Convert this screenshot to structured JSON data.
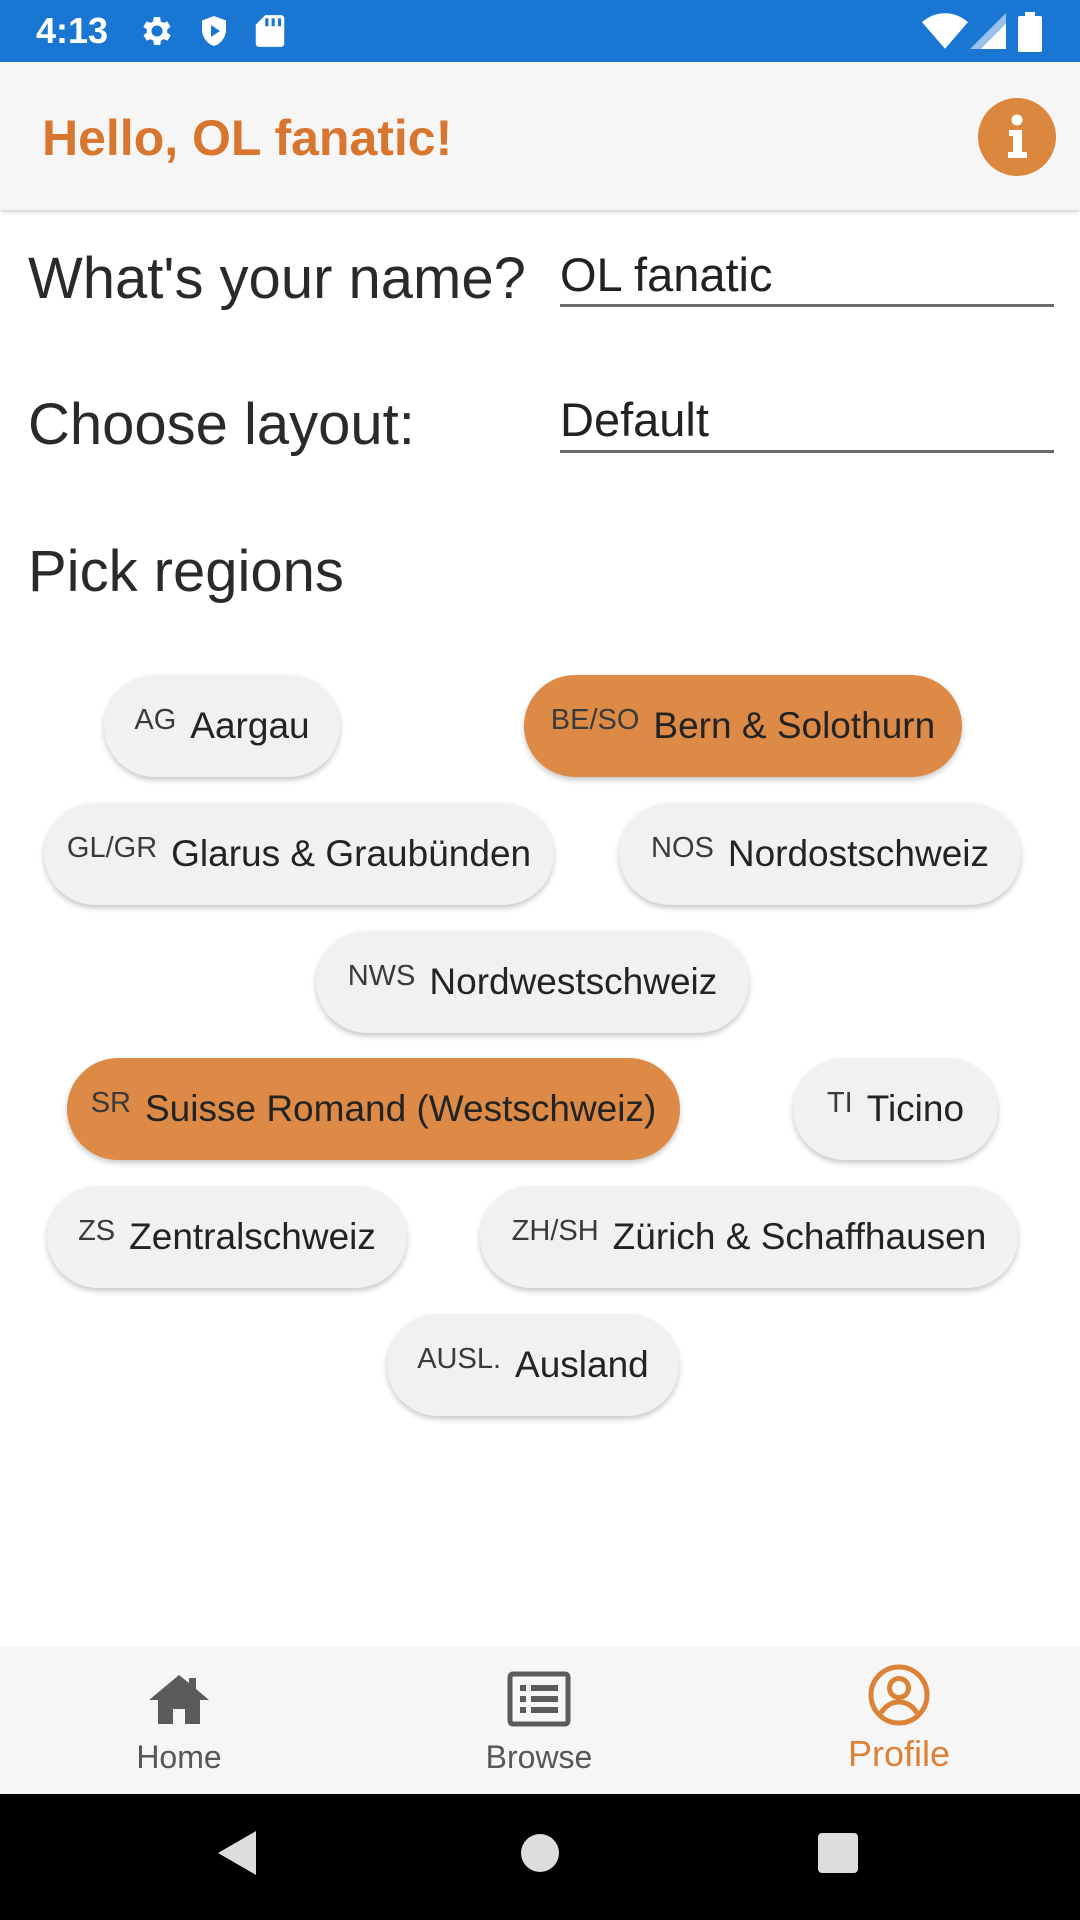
{
  "status_bar": {
    "time": "4:13",
    "left_icons": [
      "gear-icon",
      "shield-icon",
      "sd-card-icon"
    ],
    "right_icons": [
      "wifi-icon",
      "signal-icon",
      "battery-icon"
    ],
    "color": "#1976d2"
  },
  "app_bar": {
    "title": "Hello, OL fanatic!",
    "info_icon": "info-icon",
    "accent": "#d8752f"
  },
  "form": {
    "name_label": "What's your name?",
    "name_value": "OL fanatic",
    "layout_label": "Choose layout:",
    "layout_value": "Default"
  },
  "regions": {
    "heading": "Pick regions",
    "chips": [
      {
        "code": "AG",
        "name": "Aargau",
        "selected": false
      },
      {
        "code": "BE/SO",
        "name": "Bern & Solothurn",
        "selected": true
      },
      {
        "code": "GL/GR",
        "name": "Glarus & Graubünden",
        "selected": false
      },
      {
        "code": "NOS",
        "name": "Nordostschweiz",
        "selected": false
      },
      {
        "code": "NWS",
        "name": "Nordwestschweiz",
        "selected": false
      },
      {
        "code": "SR",
        "name": "Suisse Romand (Westschweiz)",
        "selected": true
      },
      {
        "code": "TI",
        "name": "Ticino",
        "selected": false
      },
      {
        "code": "ZS",
        "name": "Zentralschweiz",
        "selected": false
      },
      {
        "code": "ZH/SH",
        "name": "Zürich & Schaffhausen",
        "selected": false
      },
      {
        "code": "AUSL.",
        "name": "Ausland",
        "selected": false
      }
    ],
    "selected_color": "#dc8a45"
  },
  "bottom_nav": {
    "items": [
      {
        "label": "Home",
        "icon": "home-icon",
        "active": false
      },
      {
        "label": "Browse",
        "icon": "list-icon",
        "active": false
      },
      {
        "label": "Profile",
        "icon": "profile-icon",
        "active": true
      }
    ]
  },
  "system_nav": {
    "icons": [
      "back-icon",
      "home-circle-icon",
      "recents-icon"
    ]
  }
}
